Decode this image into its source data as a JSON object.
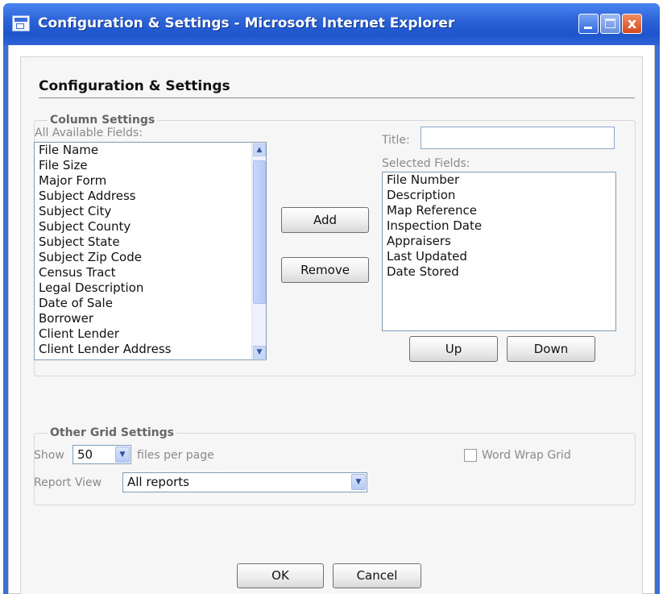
{
  "window": {
    "title": "Configuration & Settings - Microsoft Internet Explorer",
    "close_glyph": "x"
  },
  "page": {
    "heading": "Configuration & Settings"
  },
  "column_settings": {
    "legend": "Column Settings",
    "available_label": "All Available Fields:",
    "available_fields": [
      "File Name",
      "File Size",
      "Major Form",
      "Subject Address",
      "Subject City",
      "Subject County",
      "Subject State",
      "Subject Zip Code",
      "Census Tract",
      "Legal Description",
      "Date of Sale",
      "Borrower",
      "Client Lender",
      "Client Lender Address"
    ],
    "title_label": "Title:",
    "title_value": "",
    "selected_label": "Selected Fields:",
    "selected_fields": [
      "File Number",
      "Description",
      "Map Reference",
      "Inspection Date",
      "Appraisers",
      "Last Updated",
      "Date Stored"
    ],
    "add_label": "Add",
    "remove_label": "Remove",
    "up_label": "Up",
    "down_label": "Down"
  },
  "other_grid_settings": {
    "legend": "Other Grid Settings",
    "show_label": "Show",
    "per_page_value": "50",
    "files_per_page_label": "files per page",
    "word_wrap_label": "Word Wrap Grid",
    "word_wrap_checked": false,
    "report_view_label": "Report View",
    "report_view_value": "All reports"
  },
  "footer": {
    "ok_label": "OK",
    "cancel_label": "Cancel"
  }
}
